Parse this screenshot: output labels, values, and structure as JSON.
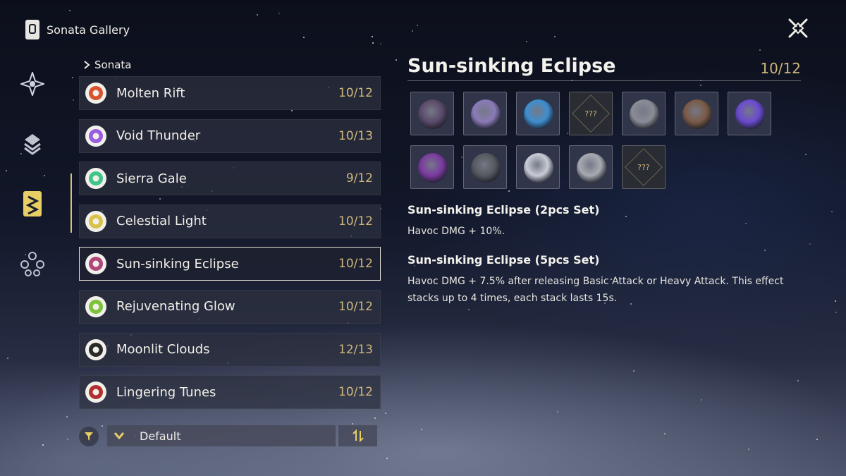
{
  "header": {
    "title": "Sonata Gallery"
  },
  "rail": {
    "icons": [
      "star-compass-icon",
      "stacked-layers-icon",
      "sonata-card-icon",
      "node-tree-icon"
    ]
  },
  "breadcrumb": {
    "label": "Sonata"
  },
  "list": {
    "items": [
      {
        "name": "Molten Rift",
        "count": "10/12",
        "icon": "fusion-icon",
        "color": "#d9532f"
      },
      {
        "name": "Void Thunder",
        "count": "10/13",
        "icon": "electro-icon",
        "color": "#9a5ce0"
      },
      {
        "name": "Sierra Gale",
        "count": "9/12",
        "icon": "aero-icon",
        "color": "#3fc58a"
      },
      {
        "name": "Celestial Light",
        "count": "10/12",
        "icon": "spectro-icon",
        "color": "#d8c24a"
      },
      {
        "name": "Sun-sinking Eclipse",
        "count": "10/12",
        "icon": "havoc-icon",
        "color": "#b0467a"
      },
      {
        "name": "Rejuvenating Glow",
        "count": "10/12",
        "icon": "healing-icon",
        "color": "#7cc23a"
      },
      {
        "name": "Moonlit Clouds",
        "count": "12/13",
        "icon": "clouds-icon",
        "color": "#2a2a2a"
      },
      {
        "name": "Lingering Tunes",
        "count": "10/12",
        "icon": "tunes-icon",
        "color": "#b43030"
      }
    ],
    "active_index": 4
  },
  "sort": {
    "label": "Default"
  },
  "detail": {
    "title": "Sun-sinking Eclipse",
    "count": "10/12",
    "echoes": [
      {
        "icon": "dark-tree-echo-icon",
        "known": true,
        "color": "#5a4a6a"
      },
      {
        "icon": "purple-orb-beast-echo-icon",
        "known": true,
        "color": "#8a7ab8"
      },
      {
        "icon": "crystal-beast-echo-icon",
        "known": true,
        "color": "#3e8fd0"
      },
      {
        "icon": "unknown-echo-icon",
        "known": false,
        "label": "???"
      },
      {
        "icon": "armored-knight-echo-icon",
        "known": true,
        "color": "#8a8c96"
      },
      {
        "icon": "owl-echo-icon",
        "known": true,
        "color": "#7a5a46"
      },
      {
        "icon": "violet-flower-echo-icon",
        "known": true,
        "color": "#6a4ad0"
      },
      {
        "icon": "tentacle-orb-echo-icon",
        "known": true,
        "color": "#7a3aa0"
      },
      {
        "icon": "wolf-echo-icon",
        "known": true,
        "color": "#55595f"
      },
      {
        "icon": "white-dragon-echo-icon",
        "known": true,
        "color": "#c8ccd6"
      },
      {
        "icon": "puffball-echo-icon",
        "known": true,
        "color": "#a8aab2"
      },
      {
        "icon": "unknown-echo-icon",
        "known": false,
        "label": "???"
      }
    ],
    "effect2_title": "Sun-sinking Eclipse (2pcs Set)",
    "effect2_desc": "Havoc DMG + 10%.",
    "effect5_title": "Sun-sinking Eclipse (5pcs Set)",
    "effect5_desc": "Havoc DMG + 7.5% after releasing Basic Attack or Heavy Attack. This effect stacks up to 4 times, each stack lasts 15s."
  },
  "colors": {
    "accent_gold": "#cdb77a",
    "active_border": "#e6e2d6"
  }
}
